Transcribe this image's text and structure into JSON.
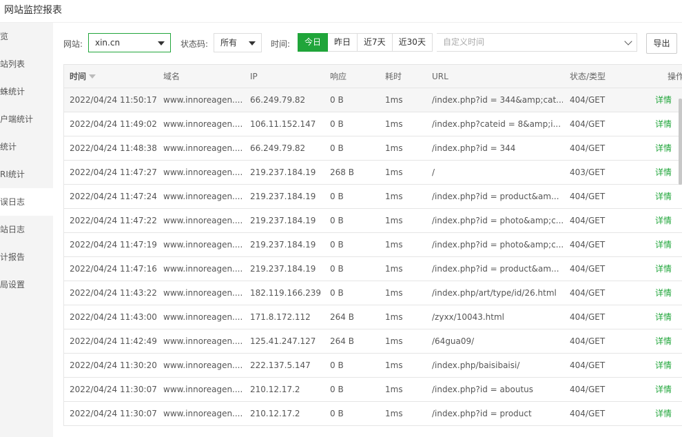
{
  "window": {
    "title": "网站监控报表"
  },
  "sidebar": {
    "items": [
      {
        "label": "览"
      },
      {
        "label": "站列表"
      },
      {
        "label": "蛛统计"
      },
      {
        "label": "户端统计"
      },
      {
        "label": "统计"
      },
      {
        "label": "RI统计"
      },
      {
        "label": "误日志",
        "active": true
      },
      {
        "label": "站日志"
      },
      {
        "label": "计报告"
      },
      {
        "label": "局设置"
      }
    ]
  },
  "filters": {
    "site_label": "网站:",
    "site_value": "xin.cn",
    "status_label": "状态码:",
    "status_value": "所有",
    "time_label": "时间:",
    "time_buttons": [
      "今日",
      "昨日",
      "近7天",
      "近30天"
    ],
    "active_time": "今日",
    "custom_time_placeholder": "自定义时间",
    "export_label": "导出"
  },
  "table": {
    "headers": [
      "时间",
      "域名",
      "IP",
      "响应",
      "耗时",
      "URL",
      "状态/类型",
      "操作"
    ],
    "sort_column": "时间",
    "rows": [
      [
        "2022/04/24 11:50:17",
        "www.innoreagen....",
        "66.249.79.82",
        "0 B",
        "1ms",
        "/index.php?id = 344&amp;cat...",
        "404/GET",
        "详情"
      ],
      [
        "2022/04/24 11:49:02",
        "www.innoreagen....",
        "106.11.152.147",
        "0 B",
        "1ms",
        "/index.php?cateid = 8&amp;i...",
        "404/GET",
        "详情"
      ],
      [
        "2022/04/24 11:48:38",
        "www.innoreagen....",
        "66.249.79.82",
        "0 B",
        "1ms",
        "/index.php?id = 344",
        "404/GET",
        "详情"
      ],
      [
        "2022/04/24 11:47:27",
        "www.innoreagen....",
        "219.237.184.19",
        "268 B",
        "1ms",
        "/",
        "403/GET",
        "详情"
      ],
      [
        "2022/04/24 11:47:24",
        "www.innoreagen....",
        "219.237.184.19",
        "0 B",
        "1ms",
        "/index.php?id = product&am...",
        "404/GET",
        "详情"
      ],
      [
        "2022/04/24 11:47:22",
        "www.innoreagen....",
        "219.237.184.19",
        "0 B",
        "1ms",
        "/index.php?id = photo&amp;c...",
        "404/GET",
        "详情"
      ],
      [
        "2022/04/24 11:47:19",
        "www.innoreagen....",
        "219.237.184.19",
        "0 B",
        "1ms",
        "/index.php?id = photo&amp;c...",
        "404/GET",
        "详情"
      ],
      [
        "2022/04/24 11:47:16",
        "www.innoreagen....",
        "219.237.184.19",
        "0 B",
        "1ms",
        "/index.php?id = product&am...",
        "404/GET",
        "详情"
      ],
      [
        "2022/04/24 11:43:22",
        "www.innoreagen....",
        "182.119.166.239",
        "0 B",
        "1ms",
        "/index.php/art/type/id/26.html",
        "404/GET",
        "详情"
      ],
      [
        "2022/04/24 11:43:00",
        "www.innoreagen....",
        "171.8.172.112",
        "264 B",
        "1ms",
        "/zyxx/10043.html",
        "404/GET",
        "详情"
      ],
      [
        "2022/04/24 11:42:49",
        "www.innoreagen....",
        "125.41.247.127",
        "264 B",
        "1ms",
        "/64gua09/",
        "404/GET",
        "详情"
      ],
      [
        "2022/04/24 11:30:20",
        "www.innoreagen....",
        "222.137.5.147",
        "0 B",
        "1ms",
        "/index.php/baisibaisi/",
        "404/GET",
        "详情"
      ],
      [
        "2022/04/24 11:30:07",
        "www.innoreagen....",
        "210.12.17.2",
        "0 B",
        "1ms",
        "/index.php?id = aboutus",
        "404/GET",
        "详情"
      ],
      [
        "2022/04/24 11:30:07",
        "www.innoreagen....",
        "210.12.17.2",
        "0 B",
        "1ms",
        "/index.php?id = product",
        "404/GET",
        "详情"
      ]
    ]
  },
  "colors": {
    "accent": "#20a53a",
    "header_bg": "#f6f6f6",
    "sidebar_bg": "#f4f4f4"
  }
}
